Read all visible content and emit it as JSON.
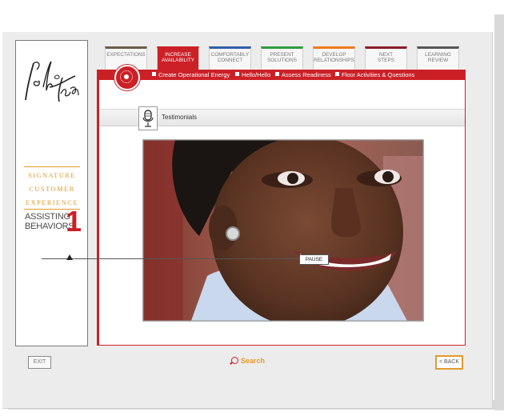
{
  "sidebar": {
    "logo_alt": "Lord & Taylor",
    "signature_lines": [
      "SIGNATURE",
      "CUSTOMER",
      "EXPERIENCE"
    ],
    "assisting_line1": "ASSISTING",
    "assisting_line2": "BEHAVIORS",
    "number": "1"
  },
  "tabs": [
    {
      "label1": "EXPECTATIONS",
      "label2": "",
      "color": "#6b5a44",
      "active": false
    },
    {
      "label1": "INCREASE",
      "label2": "AVAILABILITY",
      "color": "#cc2027",
      "active": true
    },
    {
      "label1": "COMFORTABLY",
      "label2": "CONNECT",
      "color": "#2f5fa8",
      "active": false
    },
    {
      "label1": "PRESENT",
      "label2": "SOLUTIONS",
      "color": "#2e9b3a",
      "active": false
    },
    {
      "label1": "DEVELOP",
      "label2": "RELATIONSHIPS",
      "color": "#ef7a1a",
      "active": false
    },
    {
      "label1": "NEXT",
      "label2": "STEPS",
      "color": "#8b1a2b",
      "active": false
    },
    {
      "label1": "LEARNING",
      "label2": "REVIEW",
      "color": "#555555",
      "active": false
    }
  ],
  "subnav": [
    "Create Operational Energy",
    "Hello/Hello",
    "Assess Readiness",
    "Floor Activities & Questions"
  ],
  "section": {
    "title": "Testimonials",
    "icon": "microphone-icon"
  },
  "player": {
    "pause_label": "PAUSE",
    "progress": 0.11
  },
  "footer": {
    "exit_label": "EXIT",
    "search_label": "Search",
    "back_label": "< BACK"
  },
  "colors": {
    "brand_red": "#cc2027",
    "accent_orange": "#e39a2c"
  }
}
